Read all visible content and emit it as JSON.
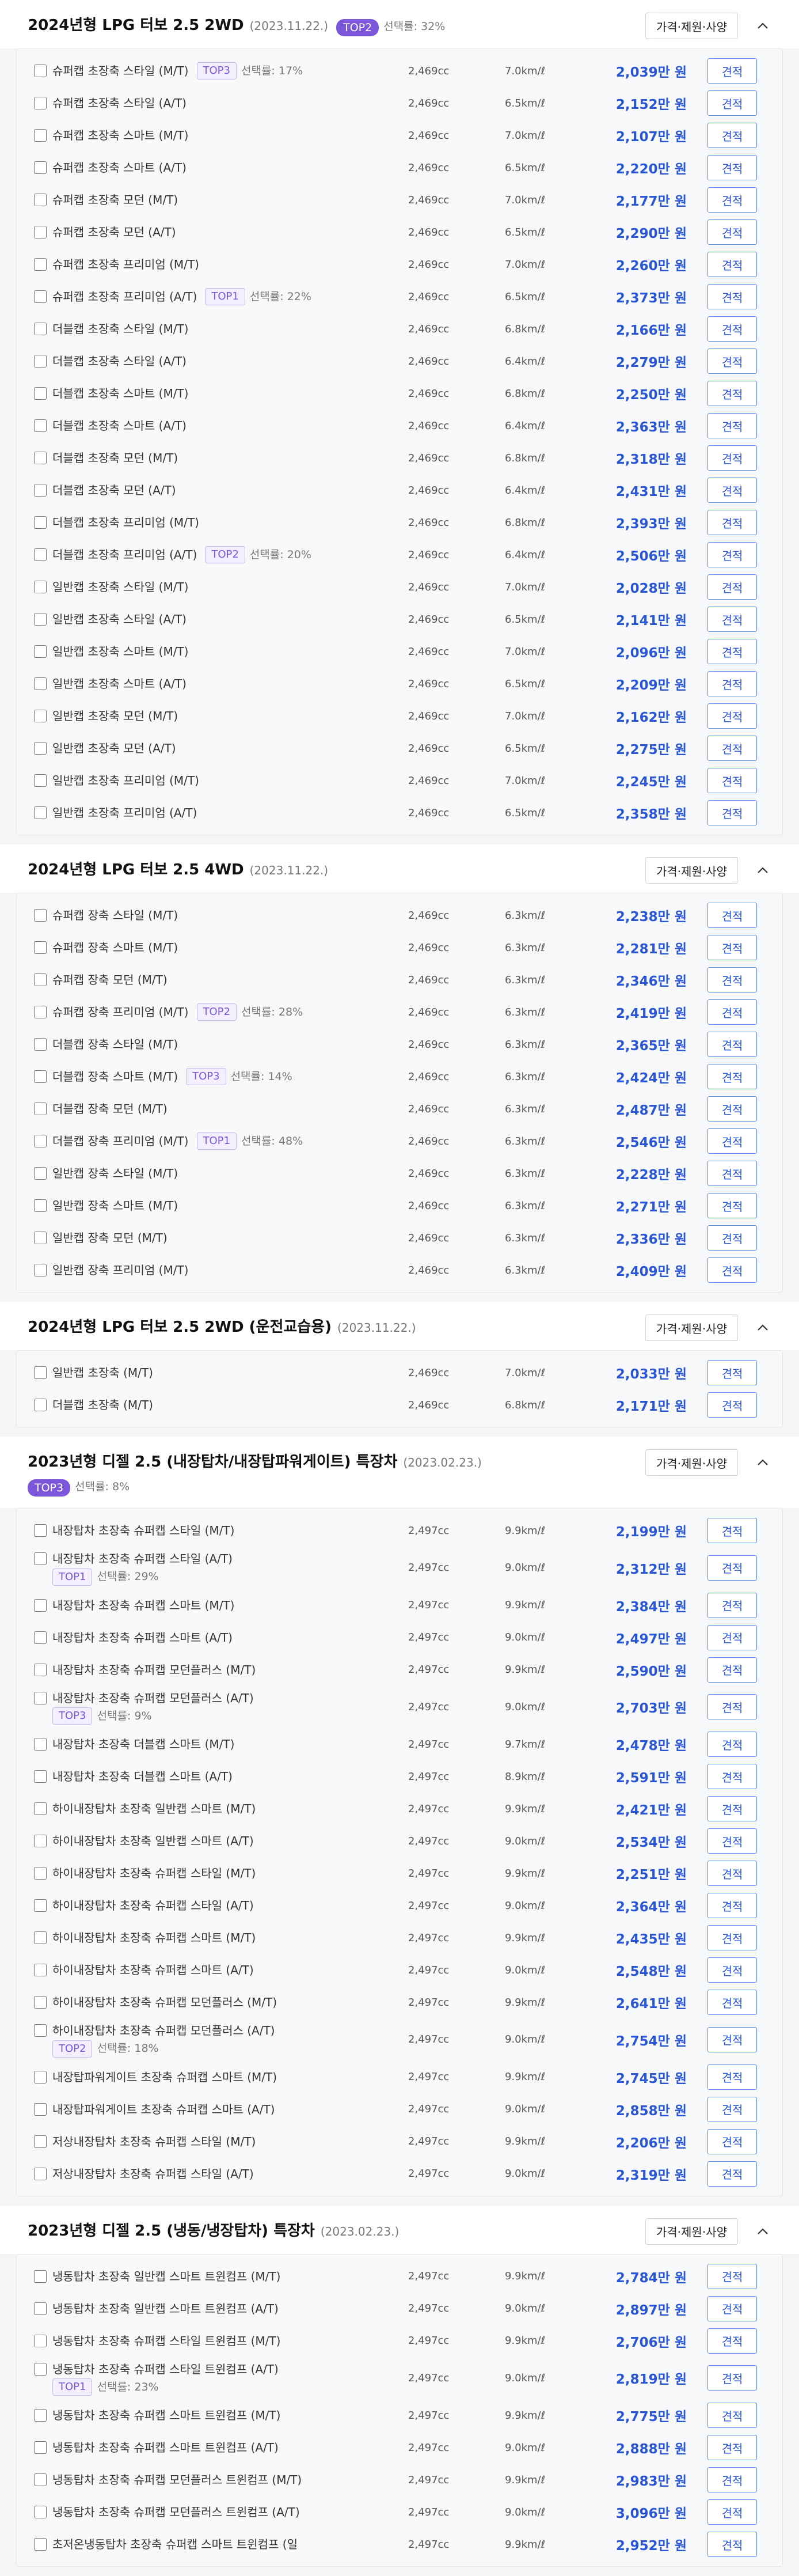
{
  "labels": {
    "spec": "가격·제원·사양",
    "quote": "견적",
    "pick_prefix": "선택률: "
  },
  "sections": [
    {
      "title": "2024년형 LPG 터보 2.5 2WD",
      "date": "(2023.11.22.)",
      "badge": "TOP2",
      "pick": "선택률: 32%",
      "rows": [
        {
          "name": "슈퍼캡 초장축 스타일 (M/T)",
          "badge": "TOP3",
          "pick": "선택률: 17%",
          "cc": "2,469cc",
          "eff": "7.0km/ℓ",
          "price": "2,039만 원"
        },
        {
          "name": "슈퍼캡 초장축 스타일 (A/T)",
          "cc": "2,469cc",
          "eff": "6.5km/ℓ",
          "price": "2,152만 원"
        },
        {
          "name": "슈퍼캡 초장축 스마트 (M/T)",
          "cc": "2,469cc",
          "eff": "7.0km/ℓ",
          "price": "2,107만 원"
        },
        {
          "name": "슈퍼캡 초장축 스마트 (A/T)",
          "cc": "2,469cc",
          "eff": "6.5km/ℓ",
          "price": "2,220만 원"
        },
        {
          "name": "슈퍼캡 초장축 모던 (M/T)",
          "cc": "2,469cc",
          "eff": "7.0km/ℓ",
          "price": "2,177만 원"
        },
        {
          "name": "슈퍼캡 초장축 모던 (A/T)",
          "cc": "2,469cc",
          "eff": "6.5km/ℓ",
          "price": "2,290만 원"
        },
        {
          "name": "슈퍼캡 초장축 프리미엄 (M/T)",
          "cc": "2,469cc",
          "eff": "7.0km/ℓ",
          "price": "2,260만 원"
        },
        {
          "name": "슈퍼캡 초장축 프리미엄 (A/T)",
          "badge": "TOP1",
          "pick": "선택률: 22%",
          "cc": "2,469cc",
          "eff": "6.5km/ℓ",
          "price": "2,373만 원"
        },
        {
          "name": "더블캡 초장축 스타일 (M/T)",
          "cc": "2,469cc",
          "eff": "6.8km/ℓ",
          "price": "2,166만 원"
        },
        {
          "name": "더블캡 초장축 스타일 (A/T)",
          "cc": "2,469cc",
          "eff": "6.4km/ℓ",
          "price": "2,279만 원"
        },
        {
          "name": "더블캡 초장축 스마트 (M/T)",
          "cc": "2,469cc",
          "eff": "6.8km/ℓ",
          "price": "2,250만 원"
        },
        {
          "name": "더블캡 초장축 스마트 (A/T)",
          "cc": "2,469cc",
          "eff": "6.4km/ℓ",
          "price": "2,363만 원"
        },
        {
          "name": "더블캡 초장축 모던 (M/T)",
          "cc": "2,469cc",
          "eff": "6.8km/ℓ",
          "price": "2,318만 원"
        },
        {
          "name": "더블캡 초장축 모던 (A/T)",
          "cc": "2,469cc",
          "eff": "6.4km/ℓ",
          "price": "2,431만 원"
        },
        {
          "name": "더블캡 초장축 프리미엄 (M/T)",
          "cc": "2,469cc",
          "eff": "6.8km/ℓ",
          "price": "2,393만 원"
        },
        {
          "name": "더블캡 초장축 프리미엄 (A/T)",
          "badge": "TOP2",
          "pick": "선택률: 20%",
          "cc": "2,469cc",
          "eff": "6.4km/ℓ",
          "price": "2,506만 원"
        },
        {
          "name": "일반캡 초장축 스타일 (M/T)",
          "cc": "2,469cc",
          "eff": "7.0km/ℓ",
          "price": "2,028만 원"
        },
        {
          "name": "일반캡 초장축 스타일 (A/T)",
          "cc": "2,469cc",
          "eff": "6.5km/ℓ",
          "price": "2,141만 원"
        },
        {
          "name": "일반캡 초장축 스마트 (M/T)",
          "cc": "2,469cc",
          "eff": "7.0km/ℓ",
          "price": "2,096만 원"
        },
        {
          "name": "일반캡 초장축 스마트 (A/T)",
          "cc": "2,469cc",
          "eff": "6.5km/ℓ",
          "price": "2,209만 원"
        },
        {
          "name": "일반캡 초장축 모던 (M/T)",
          "cc": "2,469cc",
          "eff": "7.0km/ℓ",
          "price": "2,162만 원"
        },
        {
          "name": "일반캡 초장축 모던 (A/T)",
          "cc": "2,469cc",
          "eff": "6.5km/ℓ",
          "price": "2,275만 원"
        },
        {
          "name": "일반캡 초장축 프리미엄 (M/T)",
          "cc": "2,469cc",
          "eff": "7.0km/ℓ",
          "price": "2,245만 원"
        },
        {
          "name": "일반캡 초장축 프리미엄 (A/T)",
          "cc": "2,469cc",
          "eff": "6.5km/ℓ",
          "price": "2,358만 원"
        }
      ]
    },
    {
      "title": "2024년형 LPG 터보 2.5 4WD",
      "date": "(2023.11.22.)",
      "rows": [
        {
          "name": "슈퍼캡 장축 스타일 (M/T)",
          "cc": "2,469cc",
          "eff": "6.3km/ℓ",
          "price": "2,238만 원"
        },
        {
          "name": "슈퍼캡 장축 스마트 (M/T)",
          "cc": "2,469cc",
          "eff": "6.3km/ℓ",
          "price": "2,281만 원"
        },
        {
          "name": "슈퍼캡 장축 모던 (M/T)",
          "cc": "2,469cc",
          "eff": "6.3km/ℓ",
          "price": "2,346만 원"
        },
        {
          "name": "슈퍼캡 장축 프리미엄 (M/T)",
          "badge": "TOP2",
          "pick": "선택률: 28%",
          "cc": "2,469cc",
          "eff": "6.3km/ℓ",
          "price": "2,419만 원"
        },
        {
          "name": "더블캡 장축 스타일 (M/T)",
          "cc": "2,469cc",
          "eff": "6.3km/ℓ",
          "price": "2,365만 원"
        },
        {
          "name": "더블캡 장축 스마트 (M/T)",
          "badge": "TOP3",
          "pick": "선택률: 14%",
          "cc": "2,469cc",
          "eff": "6.3km/ℓ",
          "price": "2,424만 원"
        },
        {
          "name": "더블캡 장축 모던 (M/T)",
          "cc": "2,469cc",
          "eff": "6.3km/ℓ",
          "price": "2,487만 원"
        },
        {
          "name": "더블캡 장축 프리미엄 (M/T)",
          "badge": "TOP1",
          "pick": "선택률: 48%",
          "cc": "2,469cc",
          "eff": "6.3km/ℓ",
          "price": "2,546만 원"
        },
        {
          "name": "일반캡 장축 스타일 (M/T)",
          "cc": "2,469cc",
          "eff": "6.3km/ℓ",
          "price": "2,228만 원"
        },
        {
          "name": "일반캡 장축 스마트 (M/T)",
          "cc": "2,469cc",
          "eff": "6.3km/ℓ",
          "price": "2,271만 원"
        },
        {
          "name": "일반캡 장축 모던 (M/T)",
          "cc": "2,469cc",
          "eff": "6.3km/ℓ",
          "price": "2,336만 원"
        },
        {
          "name": "일반캡 장축 프리미엄 (M/T)",
          "cc": "2,469cc",
          "eff": "6.3km/ℓ",
          "price": "2,409만 원"
        }
      ]
    },
    {
      "title": "2024년형 LPG 터보 2.5 2WD (운전교습용)",
      "date": "(2023.11.22.)",
      "rows": [
        {
          "name": "일반캡 초장축 (M/T)",
          "cc": "2,469cc",
          "eff": "7.0km/ℓ",
          "price": "2,033만 원"
        },
        {
          "name": "더블캡 초장축 (M/T)",
          "cc": "2,469cc",
          "eff": "6.8km/ℓ",
          "price": "2,171만 원"
        }
      ]
    },
    {
      "title": "2023년형 디젤 2.5 (내장탑차/내장탑파워게이트) 특장차",
      "date": "(2023.02.23.)",
      "badge": "TOP3",
      "pick": "선택률: 8%",
      "badgeNewline": true,
      "rows": [
        {
          "name": "내장탑차 초장축 슈퍼캡 스타일 (M/T)",
          "cc": "2,497cc",
          "eff": "9.9km/ℓ",
          "price": "2,199만 원"
        },
        {
          "name": "내장탑차 초장축 슈퍼캡 스타일 (A/T)",
          "badge": "TOP1",
          "pick": "선택률: 29%",
          "wrap": true,
          "cc": "2,497cc",
          "eff": "9.0km/ℓ",
          "price": "2,312만 원"
        },
        {
          "name": "내장탑차 초장축 슈퍼캡 스마트 (M/T)",
          "cc": "2,497cc",
          "eff": "9.9km/ℓ",
          "price": "2,384만 원"
        },
        {
          "name": "내장탑차 초장축 슈퍼캡 스마트 (A/T)",
          "cc": "2,497cc",
          "eff": "9.0km/ℓ",
          "price": "2,497만 원"
        },
        {
          "name": "내장탑차 초장축 슈퍼캡 모던플러스 (M/T)",
          "cc": "2,497cc",
          "eff": "9.9km/ℓ",
          "price": "2,590만 원"
        },
        {
          "name": "내장탑차 초장축 슈퍼캡 모던플러스 (A/T)",
          "badge": "TOP3",
          "pick": "선택률: 9%",
          "wrap": true,
          "cc": "2,497cc",
          "eff": "9.0km/ℓ",
          "price": "2,703만 원"
        },
        {
          "name": "내장탑차 초장축 더블캡 스마트 (M/T)",
          "cc": "2,497cc",
          "eff": "9.7km/ℓ",
          "price": "2,478만 원"
        },
        {
          "name": "내장탑차 초장축 더블캡 스마트 (A/T)",
          "cc": "2,497cc",
          "eff": "8.9km/ℓ",
          "price": "2,591만 원"
        },
        {
          "name": "하이내장탑차 초장축 일반캡 스마트 (M/T)",
          "cc": "2,497cc",
          "eff": "9.9km/ℓ",
          "price": "2,421만 원"
        },
        {
          "name": "하이내장탑차 초장축 일반캡 스마트 (A/T)",
          "cc": "2,497cc",
          "eff": "9.0km/ℓ",
          "price": "2,534만 원"
        },
        {
          "name": "하이내장탑차 초장축 슈퍼캡 스타일 (M/T)",
          "cc": "2,497cc",
          "eff": "9.9km/ℓ",
          "price": "2,251만 원"
        },
        {
          "name": "하이내장탑차 초장축 슈퍼캡 스타일 (A/T)",
          "cc": "2,497cc",
          "eff": "9.0km/ℓ",
          "price": "2,364만 원"
        },
        {
          "name": "하이내장탑차 초장축 슈퍼캡 스마트 (M/T)",
          "cc": "2,497cc",
          "eff": "9.9km/ℓ",
          "price": "2,435만 원"
        },
        {
          "name": "하이내장탑차 초장축 슈퍼캡 스마트 (A/T)",
          "cc": "2,497cc",
          "eff": "9.0km/ℓ",
          "price": "2,548만 원"
        },
        {
          "name": "하이내장탑차 초장축 슈퍼캡 모던플러스 (M/T)",
          "cc": "2,497cc",
          "eff": "9.9km/ℓ",
          "price": "2,641만 원"
        },
        {
          "name": "하이내장탑차 초장축 슈퍼캡 모던플러스 (A/T)",
          "badge": "TOP2",
          "pick": "선택률: 18%",
          "wrap": true,
          "cc": "2,497cc",
          "eff": "9.0km/ℓ",
          "price": "2,754만 원"
        },
        {
          "name": "내장탑파워게이트 초장축 슈퍼캡 스마트 (M/T)",
          "cc": "2,497cc",
          "eff": "9.9km/ℓ",
          "price": "2,745만 원"
        },
        {
          "name": "내장탑파워게이트 초장축 슈퍼캡 스마트 (A/T)",
          "cc": "2,497cc",
          "eff": "9.0km/ℓ",
          "price": "2,858만 원"
        },
        {
          "name": "저상내장탑차 초장축 슈퍼캡 스타일 (M/T)",
          "cc": "2,497cc",
          "eff": "9.9km/ℓ",
          "price": "2,206만 원"
        },
        {
          "name": "저상내장탑차 초장축 슈퍼캡 스타일 (A/T)",
          "cc": "2,497cc",
          "eff": "9.0km/ℓ",
          "price": "2,319만 원"
        }
      ]
    },
    {
      "title": "2023년형 디젤 2.5 (냉동/냉장탑차) 특장차",
      "date": "(2023.02.23.)",
      "rows": [
        {
          "name": "냉동탑차 초장축 일반캡 스마트 트윈컴프 (M/T)",
          "cc": "2,497cc",
          "eff": "9.9km/ℓ",
          "price": "2,784만 원"
        },
        {
          "name": "냉동탑차 초장축 일반캡 스마트 트윈컴프 (A/T)",
          "cc": "2,497cc",
          "eff": "9.0km/ℓ",
          "price": "2,897만 원"
        },
        {
          "name": "냉동탑차 초장축 슈퍼캡 스타일 트윈컴프 (M/T)",
          "cc": "2,497cc",
          "eff": "9.9km/ℓ",
          "price": "2,706만 원"
        },
        {
          "name": "냉동탑차 초장축 슈퍼캡 스타일 트윈컴프 (A/T)",
          "badge": "TOP1",
          "pick": "선택률: 23%",
          "wrap": true,
          "cc": "2,497cc",
          "eff": "9.0km/ℓ",
          "price": "2,819만 원"
        },
        {
          "name": "냉동탑차 초장축 슈퍼캡 스마트 트윈컴프 (M/T)",
          "cc": "2,497cc",
          "eff": "9.9km/ℓ",
          "price": "2,775만 원"
        },
        {
          "name": "냉동탑차 초장축 슈퍼캡 스마트 트윈컴프 (A/T)",
          "cc": "2,497cc",
          "eff": "9.0km/ℓ",
          "price": "2,888만 원"
        },
        {
          "name": "냉동탑차 초장축 슈퍼캡 모던플러스 트윈컴프 (M/T)",
          "cc": "2,497cc",
          "eff": "9.9km/ℓ",
          "price": "2,983만 원"
        },
        {
          "name": "냉동탑차 초장축 슈퍼캡 모던플러스 트윈컴프 (A/T)",
          "cc": "2,497cc",
          "eff": "9.0km/ℓ",
          "price": "3,096만 원"
        },
        {
          "name": "초저온냉동탑차 초장축 슈퍼캡 스마트 트윈컴프 (일",
          "cc": "2,497cc",
          "eff": "9.9km/ℓ",
          "price": "2,952만 원"
        }
      ]
    }
  ]
}
